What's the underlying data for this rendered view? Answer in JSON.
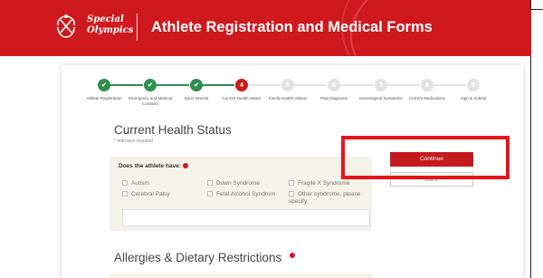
{
  "header": {
    "logo_line1": "Special",
    "logo_line2": "Olympics",
    "title": "Athlete Registration and Medical Forms"
  },
  "steps": [
    {
      "label": "Athlete Registration",
      "state": "done",
      "glyph": "✔"
    },
    {
      "label": "Emergency and Medical Contacts",
      "state": "done",
      "glyph": "✔"
    },
    {
      "label": "Sport Interest",
      "state": "done",
      "glyph": "✔"
    },
    {
      "label": "Current Health Status",
      "state": "current",
      "glyph": "4"
    },
    {
      "label": "Family Health History",
      "state": "pending",
      "glyph": "5"
    },
    {
      "label": "Past Diagnosis",
      "state": "pending",
      "glyph": "6"
    },
    {
      "label": "Neurological Symptoms",
      "state": "pending",
      "glyph": "7"
    },
    {
      "label": "Current Medications",
      "state": "pending",
      "glyph": "8"
    },
    {
      "label": "Sign & Submit",
      "state": "pending",
      "glyph": "9"
    }
  ],
  "form": {
    "section_title": "Current Health Status",
    "required_note": "* Indicates required",
    "question": "Does the athlete have:",
    "options": [
      "Autism",
      "Down Syndrome",
      "Fragile X Syndrome",
      "Cerebral Palsy",
      "Fetal Alcohol Syndrom",
      "Other syndrome, please specify"
    ],
    "specify_value": ""
  },
  "actions": {
    "continue": "Continue",
    "back": "Back"
  },
  "section2": {
    "title": "Allergies & Dietary Restrictions"
  },
  "colors": {
    "brand_red": "#d0191e",
    "done_green": "#2f8f4e",
    "highlight": "#e8141b"
  }
}
